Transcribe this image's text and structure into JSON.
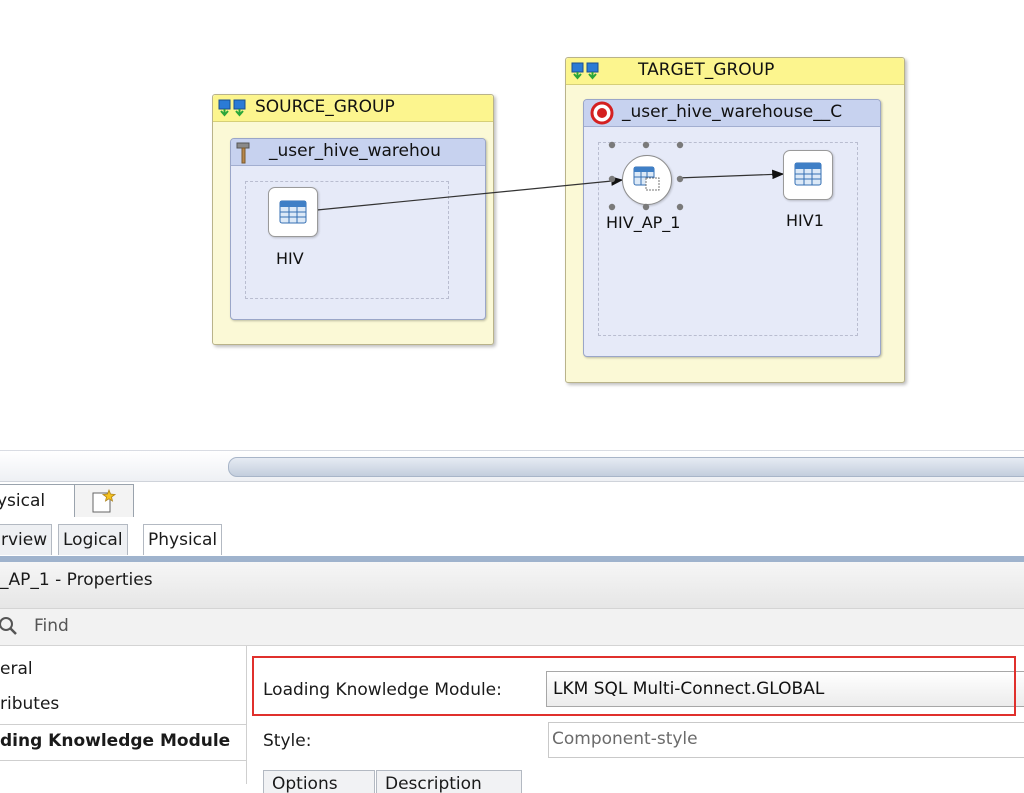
{
  "diagram": {
    "source_group": {
      "title": "SOURCE_GROUP",
      "datastore": {
        "title": "_user_hive_warehou",
        "icon": "hammer-icon"
      },
      "nodes": [
        {
          "label": "HIV",
          "icon": "table-icon"
        }
      ]
    },
    "target_group": {
      "title": "TARGET_GROUP",
      "datastore": {
        "title": "_user_hive_warehouse__C",
        "icon": "target-icon"
      },
      "nodes": [
        {
          "label": "HIV_AP_1",
          "icon": "access-point-icon"
        },
        {
          "label": "HIV1",
          "icon": "table-icon"
        }
      ]
    }
  },
  "editor_tabs": [
    {
      "label": "ysical"
    },
    {
      "label": "",
      "icon": "new-diagram-icon"
    }
  ],
  "sub_tabs": [
    {
      "label": "rview",
      "active": false
    },
    {
      "label": "Logical",
      "active": false
    },
    {
      "label": "Physical",
      "active": true
    }
  ],
  "properties": {
    "title": "_AP_1 - Properties",
    "find_placeholder": "Find",
    "nav_items": [
      {
        "label": "eral",
        "bold": false
      },
      {
        "label": "ributes",
        "bold": false
      },
      {
        "label": "ding Knowledge Module",
        "bold": true
      }
    ],
    "loading_km_label": "Loading Knowledge Module:",
    "loading_km_value": "LKM SQL Multi-Connect.GLOBAL",
    "style_label": "Style:",
    "style_value": "Component-style",
    "bottom_tabs": [
      "Options",
      "Description"
    ]
  },
  "colors": {
    "group_header": "#fcf58e",
    "datastore_header": "#c7d2ef",
    "highlight": "#e0302c"
  }
}
